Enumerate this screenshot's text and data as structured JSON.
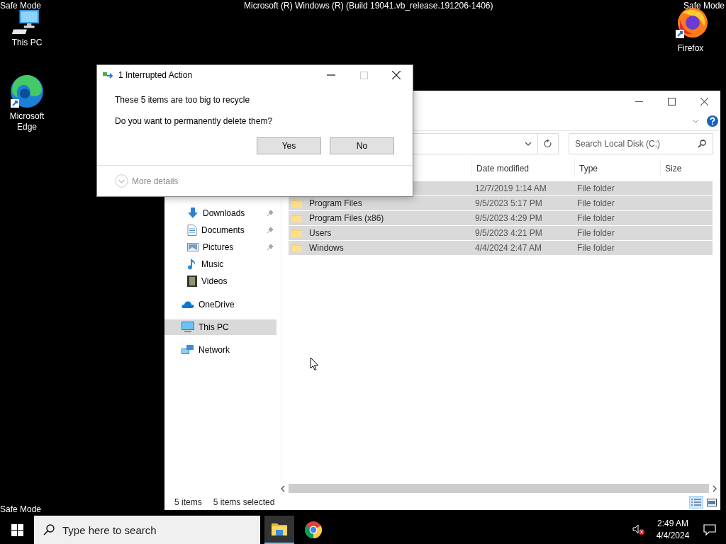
{
  "desktop": {
    "build_text": "Microsoft (R) Windows (R) (Build 19041.vb_release.191206-1406)",
    "watermarks": [
      "Safe Mode",
      "Safe Mode",
      "Safe Mode"
    ],
    "icons": [
      {
        "kind": "pc",
        "label": "This PC"
      },
      {
        "kind": "edge",
        "label": "Microsoft Edge"
      },
      {
        "kind": "firefox",
        "label": "Firefox"
      }
    ]
  },
  "dialog": {
    "title": "1 Interrupted Action",
    "message": "These 5 items are too big to recycle",
    "question": "Do you want to permanently delete them?",
    "buttons": [
      "Yes",
      "No"
    ],
    "details": "More details"
  },
  "explorer": {
    "search": {
      "placeholder": "Search Local Disk (C:)"
    },
    "columns": [
      "Date modified",
      "Type",
      "Size"
    ],
    "rows": [
      {
        "date": "12/7/2019 1:14 AM",
        "type": "File folder",
        "selected": true
      },
      {
        "name": "Program Files",
        "date": "9/5/2023 5:17 PM",
        "type": "File folder",
        "selected": true
      },
      {
        "name": "Program Files (x86)",
        "date": "9/5/2023 4:29 PM",
        "type": "File folder",
        "selected": true
      },
      {
        "name": "Users",
        "date": "9/5/2023 4:21 PM",
        "type": "File folder",
        "selected": true
      },
      {
        "name": "Windows",
        "date": "4/4/2024 2:47 AM",
        "type": "File folder",
        "selected": true
      }
    ],
    "nav": [
      {
        "children": [
          {
            "kind": "downloads",
            "label": "Downloads",
            "pinned": true,
            "selected": false
          },
          {
            "kind": "documents",
            "label": "Documents",
            "pinned": true,
            "selected": false
          },
          {
            "kind": "pictures",
            "label": "Pictures",
            "pinned": true,
            "selected": false
          },
          {
            "kind": "music",
            "label": "Music",
            "pinned": false,
            "selected": false
          },
          {
            "kind": "videos",
            "label": "Videos",
            "pinned": false,
            "selected": false
          }
        ]
      },
      {
        "kind": "onedrive",
        "label": "OneDrive",
        "selected": false
      },
      {
        "kind": "pc",
        "label": "This PC",
        "selected": true
      },
      {
        "kind": "network",
        "label": "Network",
        "selected": false
      }
    ],
    "status": [
      "5 items",
      "5 items selected"
    ]
  },
  "taskbar": {
    "search": {
      "placeholder": "Type here to search"
    },
    "apps": [
      {
        "kind": "explorer",
        "active": true
      },
      {
        "kind": "chrome",
        "active": false
      }
    ],
    "time": "2:49 AM",
    "date": "4/4/2024"
  }
}
